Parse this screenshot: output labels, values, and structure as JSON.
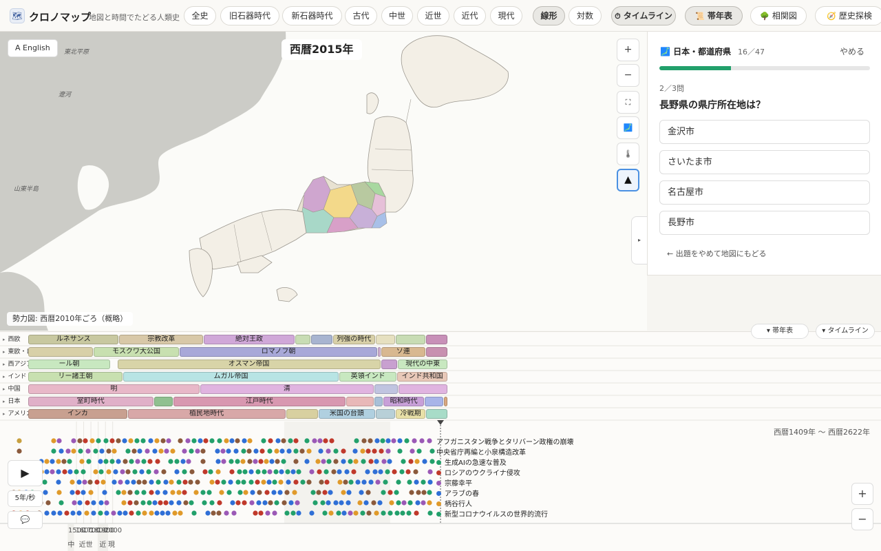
{
  "app": {
    "title": "クロノマップ",
    "tagline": "地図と時間でたどる人類史"
  },
  "nav": {
    "items": [
      {
        "label": "全史",
        "selected": false
      },
      {
        "label": "旧石器時代",
        "selected": false
      },
      {
        "label": "新石器時代",
        "selected": false
      },
      {
        "label": "古代",
        "selected": false
      },
      {
        "label": "中世",
        "selected": false
      },
      {
        "label": "近世",
        "selected": false
      },
      {
        "label": "近代",
        "selected": false
      },
      {
        "label": "現代",
        "selected": false
      }
    ],
    "scale": [
      {
        "label": "線形",
        "selected": true
      },
      {
        "label": "対数",
        "selected": false
      }
    ],
    "tools": [
      {
        "label": "タイムライン",
        "icon": "timer-icon",
        "selected": true
      },
      {
        "label": "帯年表",
        "icon": "scroll-icon",
        "selected": true
      },
      {
        "label": "相関図",
        "icon": "tree-icon",
        "selected": false
      },
      {
        "label": "歴史探検",
        "icon": "compass-icon",
        "selected": false
      }
    ]
  },
  "map": {
    "lang_button": "A English",
    "year": "西暦2015年",
    "legend": "勢力図: 西暦2010年ごろ（概略）",
    "labels": [
      "東北平原",
      "遼河",
      "山東半島"
    ],
    "controls": {
      "zoom_in": "+",
      "zoom_out": "−",
      "fit": "⛶",
      "japan": "🗾",
      "temp": "🌡",
      "terrain": "▲"
    },
    "panel_toggle": "▸"
  },
  "quiz": {
    "title": "日本・都道府県",
    "count": "16／47",
    "quit": "やめる",
    "progress": 0.34,
    "qnum": "2／3問",
    "question": "長野県の県庁所在地は？",
    "options": [
      "金沢市",
      "さいたま市",
      "名古屋市",
      "長野市"
    ],
    "back": "← 出題をやめて地図にもどる"
  },
  "toggles": {
    "band": "▾ 帯年表",
    "timeline": "▾ タイムライン"
  },
  "band_chart": {
    "rows": [
      {
        "label": "西欧",
        "bars": [
          {
            "text": "ルネサンス",
            "s": 1380,
            "e": 1520,
            "c": "#c8c8a0"
          },
          {
            "text": "宗教改革",
            "s": 1520,
            "e": 1650,
            "c": "#d8c8a8"
          },
          {
            "text": "絶対王政",
            "s": 1650,
            "e": 1790,
            "c": "#d0a8d8"
          },
          {
            "text": "",
            "s": 1790,
            "e": 1815,
            "c": "#c8dcb4"
          },
          {
            "text": "",
            "s": 1815,
            "e": 1848,
            "c": "#a8b4d0"
          },
          {
            "text": "列強の時代",
            "s": 1848,
            "e": 1914,
            "c": "#d8d0a8"
          },
          {
            "text": "",
            "s": 1914,
            "e": 1945,
            "c": "#e6e0c0"
          },
          {
            "text": "",
            "s": 1945,
            "e": 1991,
            "c": "#c8dcb4"
          },
          {
            "text": "",
            "s": 1991,
            "e": 2025,
            "c": "#c890b8"
          }
        ]
      },
      {
        "label": "東欧・ロシア",
        "bars": [
          {
            "text": "",
            "s": 1380,
            "e": 1480,
            "c": "#d8d0a8"
          },
          {
            "text": "モスクワ大公国",
            "s": 1480,
            "e": 1613,
            "c": "#c8e0b0"
          },
          {
            "text": "ロマノフ朝",
            "s": 1613,
            "e": 1917,
            "c": "#a8a8d8"
          },
          {
            "text": "",
            "s": 1917,
            "e": 1922,
            "c": "#d0b0d0"
          },
          {
            "text": "ソ連",
            "s": 1922,
            "e": 1991,
            "c": "#d8b890"
          },
          {
            "text": "",
            "s": 1991,
            "e": 2025,
            "c": "#c890b0"
          }
        ]
      },
      {
        "label": "西アジア",
        "bars": [
          {
            "text": "ール朝",
            "s": 1380,
            "e": 1507,
            "c": "#c8e8c0"
          },
          {
            "text": "オスマン帝国",
            "s": 1517,
            "e": 1922,
            "c": "#d8d4a8"
          },
          {
            "text": "",
            "s": 1922,
            "e": 1948,
            "c": "#c8a0d0"
          },
          {
            "text": "現代の中東",
            "s": 1948,
            "e": 2025,
            "c": "#c8e8c0"
          }
        ]
      },
      {
        "label": "インド",
        "bars": [
          {
            "text": "リー諸王朝",
            "s": 1380,
            "e": 1526,
            "c": "#c8e0b0"
          },
          {
            "text": "ムガル帝国",
            "s": 1526,
            "e": 1858,
            "c": "#b8e4e4"
          },
          {
            "text": "英領インド",
            "s": 1858,
            "e": 1947,
            "c": "#c8e8c0"
          },
          {
            "text": "インド共和国",
            "s": 1947,
            "e": 2025,
            "c": "#e8c8b8"
          }
        ]
      },
      {
        "label": "中国",
        "bars": [
          {
            "text": "明",
            "s": 1380,
            "e": 1644,
            "c": "#e8b8c8"
          },
          {
            "text": "清",
            "s": 1644,
            "e": 1912,
            "c": "#e0b4e0"
          },
          {
            "text": "",
            "s": 1912,
            "e": 1949,
            "c": "#c0c4e0"
          },
          {
            "text": "",
            "s": 1949,
            "e": 2025,
            "c": "#e0b4e0"
          }
        ]
      },
      {
        "label": "日本",
        "bars": [
          {
            "text": "室町時代",
            "s": 1380,
            "e": 1573,
            "c": "#e0b0c8"
          },
          {
            "text": "",
            "s": 1573,
            "e": 1603,
            "c": "#90c090"
          },
          {
            "text": "江戸時代",
            "s": 1603,
            "e": 1868,
            "c": "#d898b0"
          },
          {
            "text": "",
            "s": 1868,
            "e": 1912,
            "c": "#e8b8b8"
          },
          {
            "text": "",
            "s": 1912,
            "e": 1926,
            "c": "#a8c0d8"
          },
          {
            "text": "昭和時代",
            "s": 1926,
            "e": 1989,
            "c": "#c8a0d8"
          },
          {
            "text": "",
            "s": 1989,
            "e": 2019,
            "c": "#a8b4e8"
          },
          {
            "text": "",
            "s": 2019,
            "e": 2025,
            "c": "#d8a880"
          }
        ]
      },
      {
        "label": "アメリカ大陸",
        "bars": [
          {
            "text": "インカ",
            "s": 1380,
            "e": 1533,
            "c": "#c8a090"
          },
          {
            "text": "植民地時代",
            "s": 1533,
            "e": 1776,
            "c": "#d8a8a8"
          },
          {
            "text": "",
            "s": 1776,
            "e": 1826,
            "c": "#d8d0a0"
          },
          {
            "text": "米国の台頭",
            "s": 1826,
            "e": 1914,
            "c": "#b0d0e0"
          },
          {
            "text": "",
            "s": 1914,
            "e": 1945,
            "c": "#b8d0d8"
          },
          {
            "text": "冷戦期",
            "s": 1945,
            "e": 1991,
            "c": "#e8e0a8"
          },
          {
            "text": "",
            "s": 1991,
            "e": 2025,
            "c": "#a8dcc8"
          }
        ]
      }
    ]
  },
  "timeline": {
    "range": "西暦1409年 〜 西暦2622年",
    "play": "▶",
    "speed": "5年/秒",
    "speech": "💬",
    "zoom_in": "+",
    "zoom_out": "−",
    "ticks": [
      "1500",
      "1600",
      "1700",
      "1800",
      "1900",
      "2000"
    ],
    "eras": [
      {
        "label": "中世",
        "s": 1380,
        "e": 1466
      },
      {
        "label": "近世",
        "s": 1466,
        "e": 1792
      },
      {
        "label": "近代",
        "s": 1792,
        "e": 1936
      },
      {
        "label": "現代",
        "s": 1936,
        "e": 2025
      }
    ],
    "events": [
      {
        "text": "アフガニスタン戦争とタリバーン政権の崩壊",
        "color": "",
        "dash": true
      },
      {
        "text": "中央省庁再編と小泉構造改革",
        "color": "",
        "dash": true
      },
      {
        "text": "生成AIの急速な普及",
        "color": "#22a06b",
        "dash": false
      },
      {
        "text": "ロシアのウクライナ侵攻",
        "color": "#c0392b",
        "dash": false
      },
      {
        "text": "宗藤幸平",
        "color": "#9b59b6",
        "dash": false
      },
      {
        "text": "アラブの春",
        "color": "#2f6fd6",
        "dash": false
      },
      {
        "text": "柄谷行人",
        "color": "#e09a2a",
        "dash": false
      },
      {
        "text": "新型コロナウイルスの世界的流行",
        "color": "#22a06b",
        "dash": false
      }
    ]
  }
}
